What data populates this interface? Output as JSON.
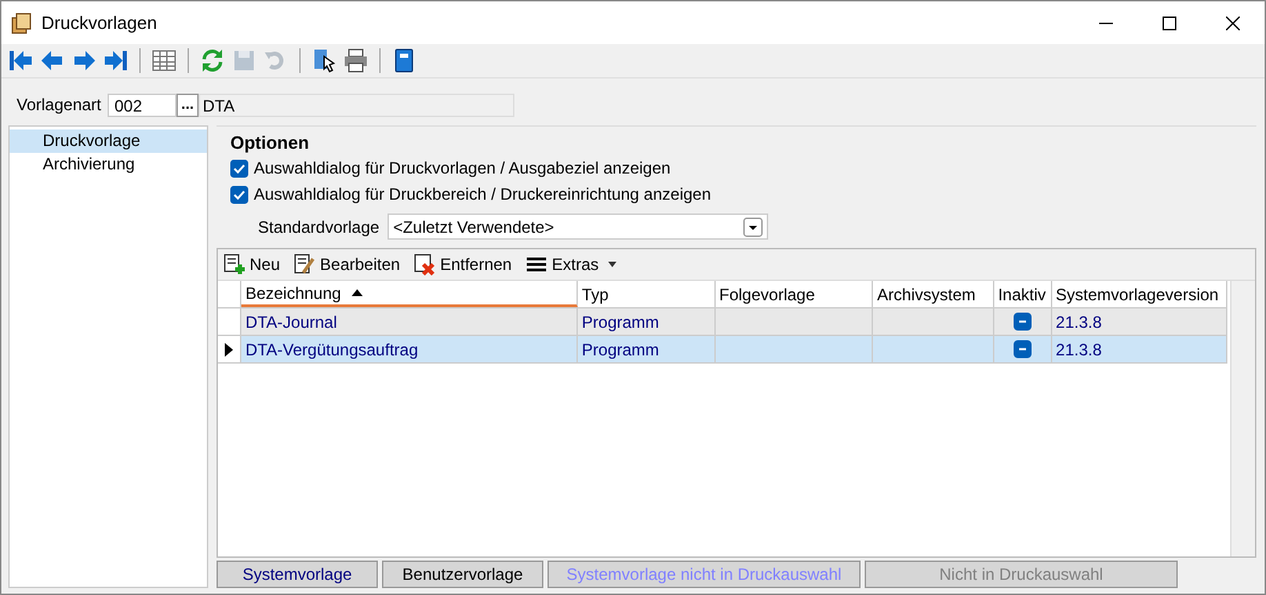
{
  "window": {
    "title": "Druckvorlagen"
  },
  "vorlagenart": {
    "label": "Vorlagenart",
    "code": "002",
    "browse": "...",
    "name": "DTA"
  },
  "sidebar": {
    "items": [
      {
        "label": "Druckvorlage",
        "selected": true
      },
      {
        "label": "Archivierung",
        "selected": false
      }
    ]
  },
  "options": {
    "title": "Optionen",
    "checks": [
      {
        "label": "Auswahldialog für Druckvorlagen / Ausgabeziel anzeigen",
        "checked": true
      },
      {
        "label": "Auswahldialog für Druckbereich / Druckereinrichtung anzeigen",
        "checked": true
      }
    ],
    "standard": {
      "label": "Standardvorlage",
      "value": "<Zuletzt Verwendete>"
    }
  },
  "grid_toolbar": [
    {
      "label": "Neu",
      "kind": "new"
    },
    {
      "label": "Bearbeiten",
      "kind": "edit"
    },
    {
      "label": "Entfernen",
      "kind": "delete"
    },
    {
      "label": "Extras",
      "kind": "menu"
    }
  ],
  "table": {
    "columns": [
      "Bezeichnung",
      "Typ",
      "Folgevorlage",
      "Archivsystem",
      "Inaktiv",
      "Systemvorlageversion"
    ],
    "rows": [
      {
        "bezeichnung": "DTA-Journal",
        "typ": "Programm",
        "inaktiv_indeterminate": true,
        "version": "21.3.8",
        "selected": false
      },
      {
        "bezeichnung": "DTA-Vergütungsauftrag",
        "typ": "Programm",
        "inaktiv_indeterminate": true,
        "version": "21.3.8",
        "selected": true
      }
    ]
  },
  "legend": [
    {
      "label": "Systemvorlage",
      "color": "#000080"
    },
    {
      "label": "Benutzervorlage",
      "color": "#000000"
    },
    {
      "label": "Systemvorlage nicht in Druckauswahl",
      "color": "#8080ff"
    },
    {
      "label": "Nicht in Druckauswahl",
      "color": "#808080"
    }
  ]
}
